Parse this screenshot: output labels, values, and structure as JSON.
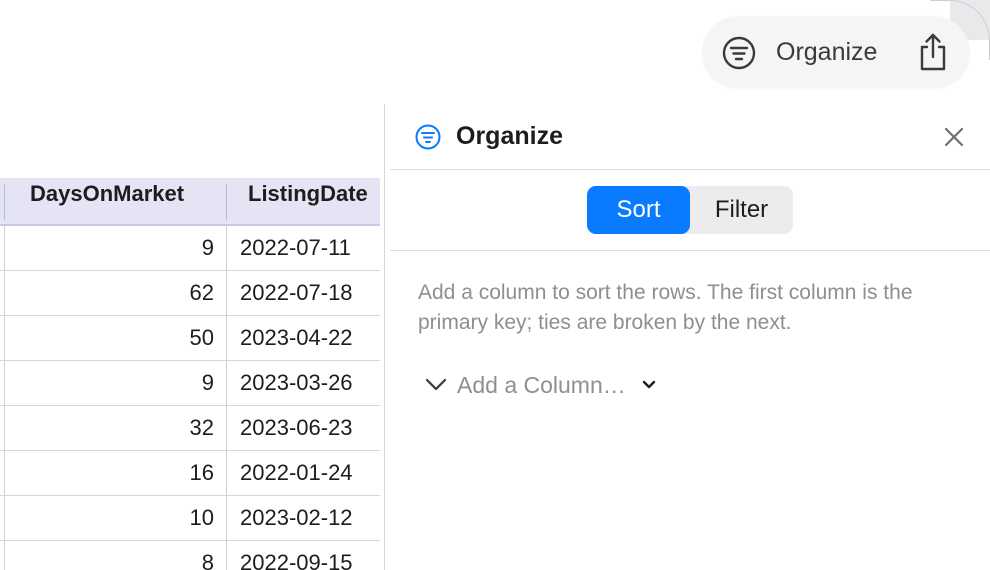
{
  "toolbar": {
    "organize_label": "Organize",
    "organize_icon": "filter-lines-icon",
    "share_icon": "share-icon"
  },
  "table": {
    "columns": [
      "DaysOnMarket",
      "ListingDate"
    ],
    "rows": [
      {
        "days": "9",
        "date": "2022-07-11"
      },
      {
        "days": "62",
        "date": "2022-07-18"
      },
      {
        "days": "50",
        "date": "2023-04-22"
      },
      {
        "days": "9",
        "date": "2023-03-26"
      },
      {
        "days": "32",
        "date": "2023-06-23"
      },
      {
        "days": "16",
        "date": "2022-01-24"
      },
      {
        "days": "10",
        "date": "2023-02-12"
      },
      {
        "days": "8",
        "date": "2022-09-15"
      }
    ],
    "header_bg": "#e4e4f5"
  },
  "panel": {
    "title": "Organize",
    "tabs": [
      {
        "label": "Sort",
        "selected": true
      },
      {
        "label": "Filter",
        "selected": false
      }
    ],
    "description": "Add a column to sort the rows. The first column is the primary key; ties are broken by the next.",
    "add_column_label": "Add a Column…",
    "accent": "#0a7aff"
  }
}
